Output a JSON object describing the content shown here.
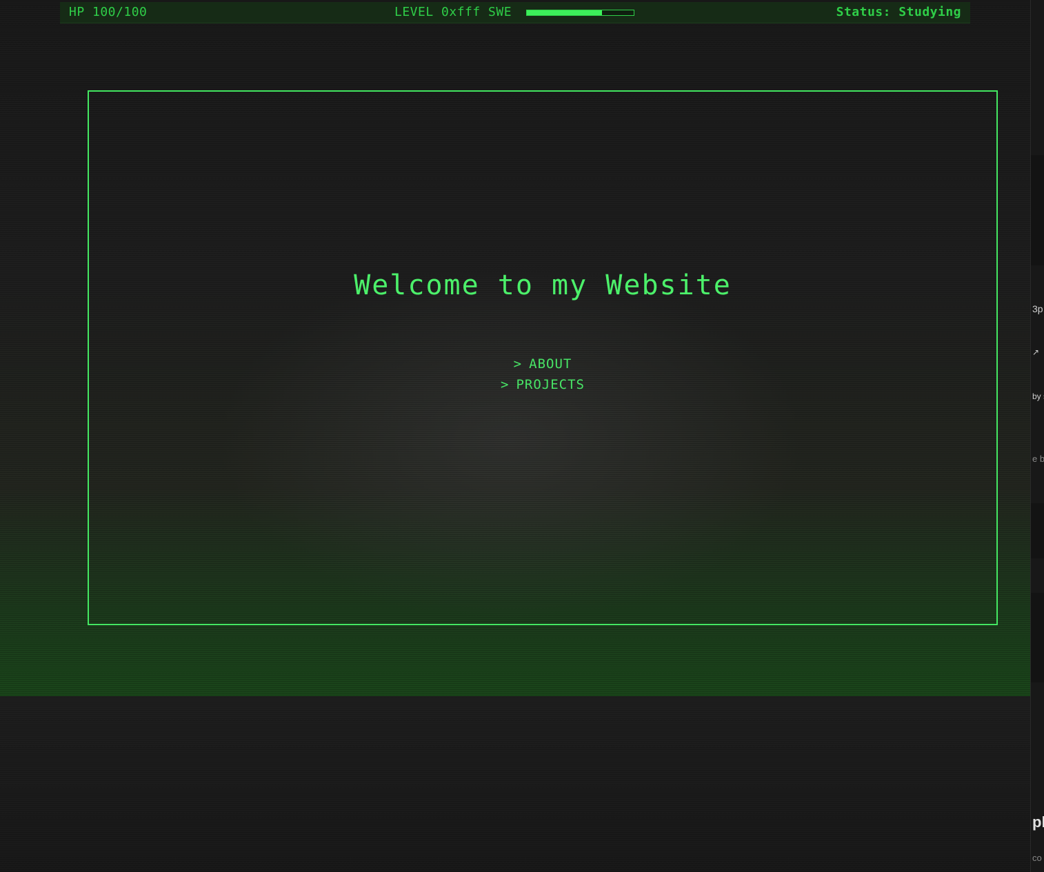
{
  "hud": {
    "hp": "HP 100/100",
    "level": "LEVEL 0xfff SWE",
    "xp_progress": 0.7,
    "status": "Status: Studying"
  },
  "main": {
    "title": "Welcome to my Website",
    "menu": [
      {
        "prompt": ">",
        "label": "ABOUT"
      },
      {
        "prompt": ">",
        "label": "PROJECTS"
      }
    ]
  },
  "side_panel": {
    "fragments": [
      "3p",
      "by s",
      "e bl",
      "pl",
      "co"
    ]
  },
  "colors": {
    "accent": "#44e862",
    "hud_text": "#2fce48",
    "background": "#1d1d1d"
  }
}
